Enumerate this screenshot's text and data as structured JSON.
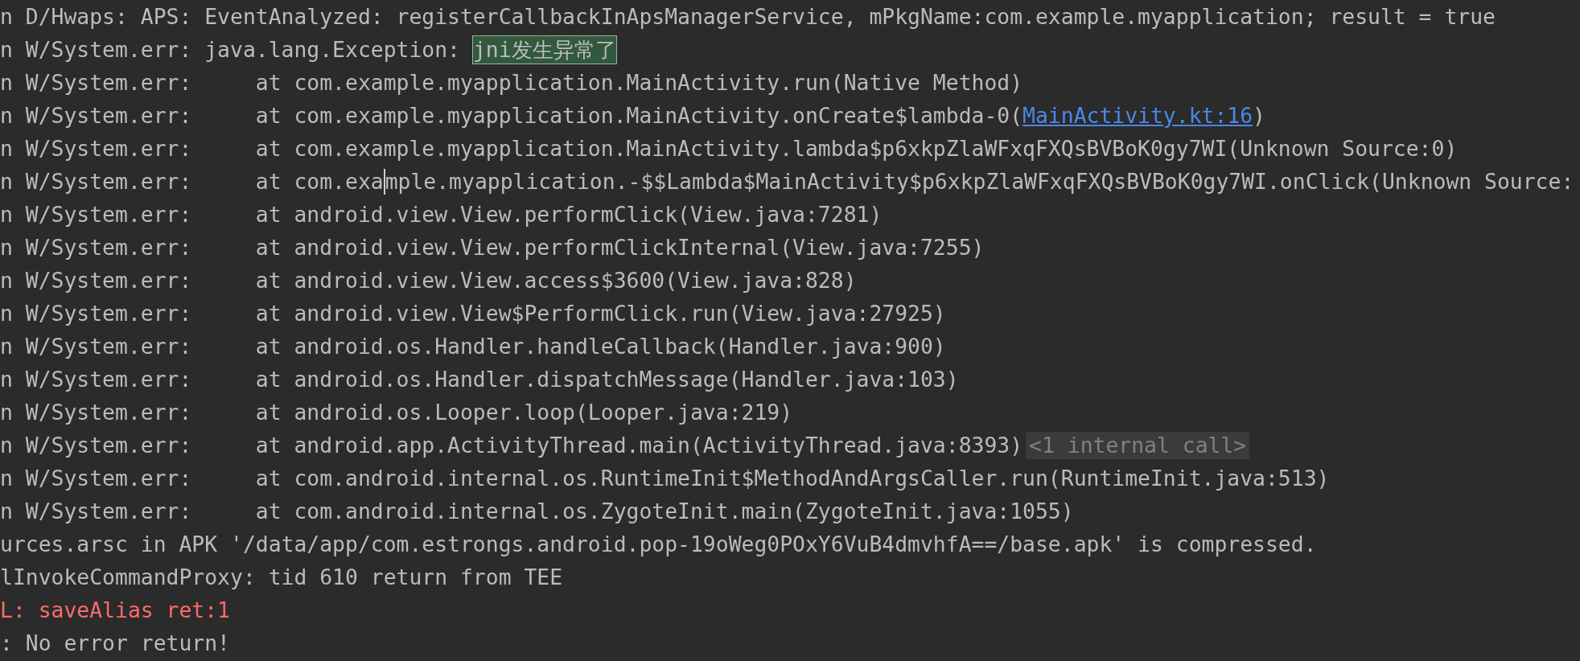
{
  "log_lines": [
    {
      "color": "#bbbbbb",
      "segments": [
        {
          "kind": "text",
          "text": "n D/Hwaps: APS: EventAnalyzed: registerCallbackInApsManagerService, mPkgName:com.example.myapplication; result = true"
        }
      ]
    },
    {
      "color": "#bbbbbb",
      "segments": [
        {
          "kind": "text",
          "text": "n W/System.err: java.lang.Exception: "
        },
        {
          "kind": "highlight",
          "text": "jni发生异常了"
        }
      ]
    },
    {
      "color": "#bbbbbb",
      "segments": [
        {
          "kind": "text",
          "text": "n W/System.err:     at com.example.myapplication.MainActivity.run(Native Method)"
        }
      ]
    },
    {
      "color": "#bbbbbb",
      "segments": [
        {
          "kind": "text",
          "text": "n W/System.err:     at com.example.myapplication.MainActivity.onCreate$lambda-0("
        },
        {
          "kind": "link",
          "text": "MainActivity.kt:16"
        },
        {
          "kind": "text",
          "text": ")"
        }
      ]
    },
    {
      "color": "#bbbbbb",
      "segments": [
        {
          "kind": "text",
          "text": "n W/System.err:     at com.example.myapplication.MainActivity.lambda$p6xkpZlaWFxqFXQsBVBoK0gy7WI(Unknown Source:0)"
        }
      ]
    },
    {
      "color": "#bbbbbb",
      "segments": [
        {
          "kind": "text",
          "text": "n W/System.err:     at com.exa"
        },
        {
          "kind": "caret"
        },
        {
          "kind": "text",
          "text": "mple.myapplication.-$$Lambda$MainActivity$p6xkpZlaWFxqFXQsBVBoK0gy7WI.onClick(Unknown Source:"
        }
      ]
    },
    {
      "color": "#bbbbbb",
      "segments": [
        {
          "kind": "text",
          "text": "n W/System.err:     at android.view.View.performClick(View.java:7281)"
        }
      ]
    },
    {
      "color": "#bbbbbb",
      "segments": [
        {
          "kind": "text",
          "text": "n W/System.err:     at android.view.View.performClickInternal(View.java:7255)"
        }
      ]
    },
    {
      "color": "#bbbbbb",
      "segments": [
        {
          "kind": "text",
          "text": "n W/System.err:     at android.view.View.access$3600(View.java:828)"
        }
      ]
    },
    {
      "color": "#bbbbbb",
      "segments": [
        {
          "kind": "text",
          "text": "n W/System.err:     at android.view.View$PerformClick.run(View.java:27925)"
        }
      ]
    },
    {
      "color": "#bbbbbb",
      "segments": [
        {
          "kind": "text",
          "text": "n W/System.err:     at android.os.Handler.handleCallback(Handler.java:900)"
        }
      ]
    },
    {
      "color": "#bbbbbb",
      "segments": [
        {
          "kind": "text",
          "text": "n W/System.err:     at android.os.Handler.dispatchMessage(Handler.java:103)"
        }
      ]
    },
    {
      "color": "#bbbbbb",
      "segments": [
        {
          "kind": "text",
          "text": "n W/System.err:     at android.os.Looper.loop(Looper.java:219)"
        }
      ]
    },
    {
      "color": "#bbbbbb",
      "segments": [
        {
          "kind": "text",
          "text": "n W/System.err:     at android.app.ActivityThread.main(ActivityThread.java:8393)"
        },
        {
          "kind": "folded",
          "text": "<1 internal call>"
        }
      ]
    },
    {
      "color": "#bbbbbb",
      "segments": [
        {
          "kind": "text",
          "text": "n W/System.err:     at com.android.internal.os.RuntimeInit$MethodAndArgsCaller.run(RuntimeInit.java:513)"
        }
      ]
    },
    {
      "color": "#bbbbbb",
      "segments": [
        {
          "kind": "text",
          "text": "n W/System.err:     at com.android.internal.os.ZygoteInit.main(ZygoteInit.java:1055)"
        }
      ]
    },
    {
      "color": "#bbbbbb",
      "segments": [
        {
          "kind": "text",
          "text": "urces.arsc in APK '/data/app/com.estrongs.android.pop-19oWeg0POxY6VuB4dmvhfA==/base.apk' is compressed."
        }
      ]
    },
    {
      "color": "#bbbbbb",
      "segments": [
        {
          "kind": "text",
          "text": "lInvokeCommandProxy: tid 610 return from TEE"
        }
      ]
    },
    {
      "color": "#ff6b68",
      "segments": [
        {
          "kind": "text",
          "text": "L: saveAlias ret:1"
        }
      ]
    },
    {
      "color": "#bbbbbb",
      "segments": [
        {
          "kind": "text",
          "text": ": No error return!"
        }
      ]
    }
  ]
}
